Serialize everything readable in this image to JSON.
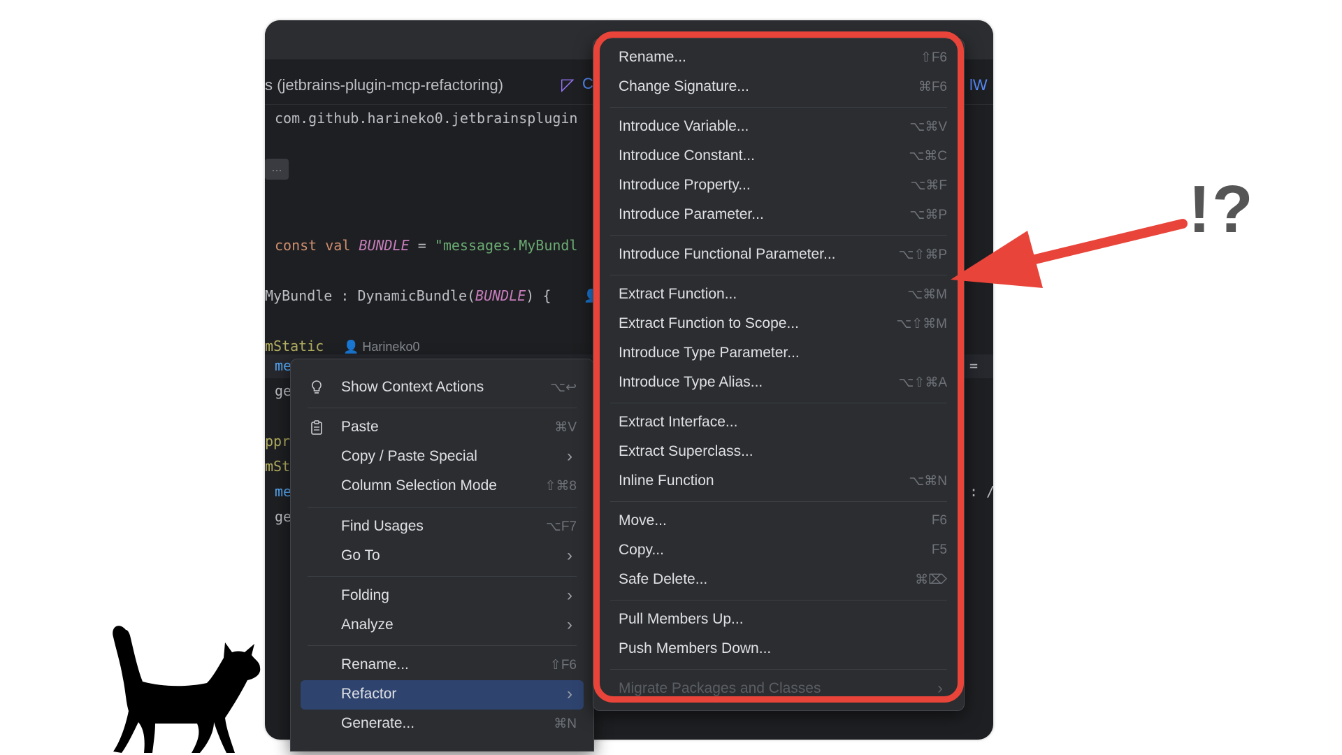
{
  "editor": {
    "project_tab": "s (jetbrains-plugin-mcp-refactoring)",
    "tab_c": "C",
    "tab_right": "lW",
    "lines": {
      "package": "com.github.harineko0.jetbrainsplugin",
      "fold": "...",
      "const_kw": "const val ",
      "const_name": "BUNDLE",
      "const_eq": " = ",
      "const_str": "\"messages.MyBundl",
      "obj_name": "MyBundle : DynamicBundle(",
      "obj_arg": "BUNDLE",
      "obj_end": ") {",
      "ann1": "mStatic",
      "author": "Harineko0",
      "me1": "me",
      "ge1": "ge",
      "ppr": "ppr",
      "mst": "mSt",
      "me2": "me",
      "ge2": "ge",
      "right_eq": "=",
      "right_colon": ": /"
    }
  },
  "context_menu": {
    "items": [
      {
        "label": "Show Context Actions",
        "shortcut": "⌥↩",
        "icon": "bulb-icon"
      },
      {
        "label": "Paste",
        "shortcut": "⌘V",
        "icon": "clipboard-icon"
      },
      {
        "label": "Copy / Paste Special",
        "submenu": true
      },
      {
        "label": "Column Selection Mode",
        "shortcut": "⇧⌘8"
      },
      {
        "label": "Find Usages",
        "shortcut": "⌥F7"
      },
      {
        "label": "Go To",
        "submenu": true
      },
      {
        "label": "Folding",
        "submenu": true
      },
      {
        "label": "Analyze",
        "submenu": true
      },
      {
        "label": "Rename...",
        "shortcut": "⇧F6"
      },
      {
        "label": "Refactor",
        "submenu": true,
        "selected": true
      },
      {
        "label": "Generate...",
        "shortcut": "⌘N"
      }
    ]
  },
  "refactor_menu": {
    "items": [
      {
        "label": "Rename...",
        "shortcut": "⇧F6"
      },
      {
        "label": "Change Signature...",
        "shortcut": "⌘F6"
      },
      {
        "label": "Introduce Variable...",
        "shortcut": "⌥⌘V"
      },
      {
        "label": "Introduce Constant...",
        "shortcut": "⌥⌘C"
      },
      {
        "label": "Introduce Property...",
        "shortcut": "⌥⌘F"
      },
      {
        "label": "Introduce Parameter...",
        "shortcut": "⌥⌘P"
      },
      {
        "label": "Introduce Functional Parameter...",
        "shortcut": "⌥⇧⌘P"
      },
      {
        "label": "Extract Function...",
        "shortcut": "⌥⌘M"
      },
      {
        "label": "Extract Function to Scope...",
        "shortcut": "⌥⇧⌘M"
      },
      {
        "label": "Introduce Type Parameter...",
        "shortcut": ""
      },
      {
        "label": "Introduce Type Alias...",
        "shortcut": "⌥⇧⌘A"
      },
      {
        "label": "Extract Interface...",
        "shortcut": ""
      },
      {
        "label": "Extract Superclass...",
        "shortcut": ""
      },
      {
        "label": "Inline Function",
        "shortcut": "⌥⌘N"
      },
      {
        "label": "Move...",
        "shortcut": "F6"
      },
      {
        "label": "Copy...",
        "shortcut": "F5"
      },
      {
        "label": "Safe Delete...",
        "shortcut": "⌘⌦"
      },
      {
        "label": "Pull Members Up...",
        "shortcut": ""
      },
      {
        "label": "Push Members Down...",
        "shortcut": ""
      },
      {
        "label": "Migrate Packages and Classes",
        "submenu": true,
        "disabled": true
      }
    ]
  },
  "annotation": {
    "text": "!?",
    "color": "#e8443a"
  }
}
